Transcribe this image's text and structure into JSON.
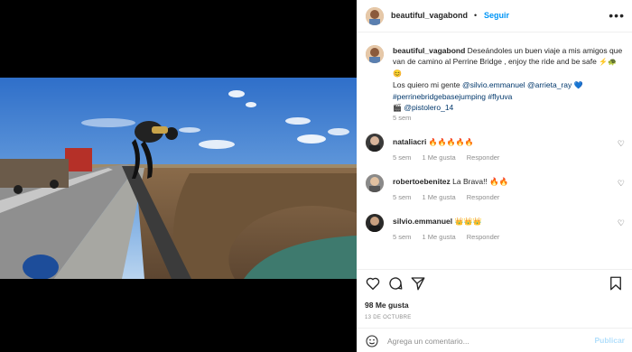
{
  "post": {
    "author": "beautiful_vagabond",
    "follow_label": "Seguir",
    "more_icon": "more-horizontal-icon"
  },
  "caption": {
    "author": "beautiful_vagabond",
    "text_1": "Deseándoles un buen viaje a mis amigos que",
    "text_2": "van de camino al Perrine Bridge , enjoy the ride and be safe",
    "emoji_1": "⚡🐢",
    "emoji_2": "😊",
    "line3_prefix": "Los quiero mi gente ",
    "mention_1": "@silvio.emmanuel",
    "mention_2": "@arrieta_ray",
    "heart": "💙",
    "hashtags": "#perrinebridgebasejumping #flyuva",
    "clapper": "🎬",
    "mention_3": "@pistolero_14",
    "time": "5 sem"
  },
  "comments": [
    {
      "user": "nataliacri",
      "text": "🔥🔥🔥🔥🔥",
      "time": "5 sem",
      "likes": "1 Me gusta",
      "reply": "Responder"
    },
    {
      "user": "robertoebenitez",
      "text": "La Brava!! 🔥🔥",
      "time": "5 sem",
      "likes": "1 Me gusta",
      "reply": "Responder"
    },
    {
      "user": "silvio.emmanuel",
      "text": "👑👑👑",
      "time": "5 sem",
      "likes": "1 Me gusta",
      "reply": "Responder"
    }
  ],
  "actions": {
    "likes_label": "98 Me gusta",
    "date_label": "13 DE OCTUBRE"
  },
  "add_comment": {
    "placeholder": "Agrega un comentario...",
    "publish_label": "Publicar"
  },
  "colors": {
    "link": "#00376b",
    "follow": "#0095f6",
    "muted": "#8e8e8e"
  }
}
